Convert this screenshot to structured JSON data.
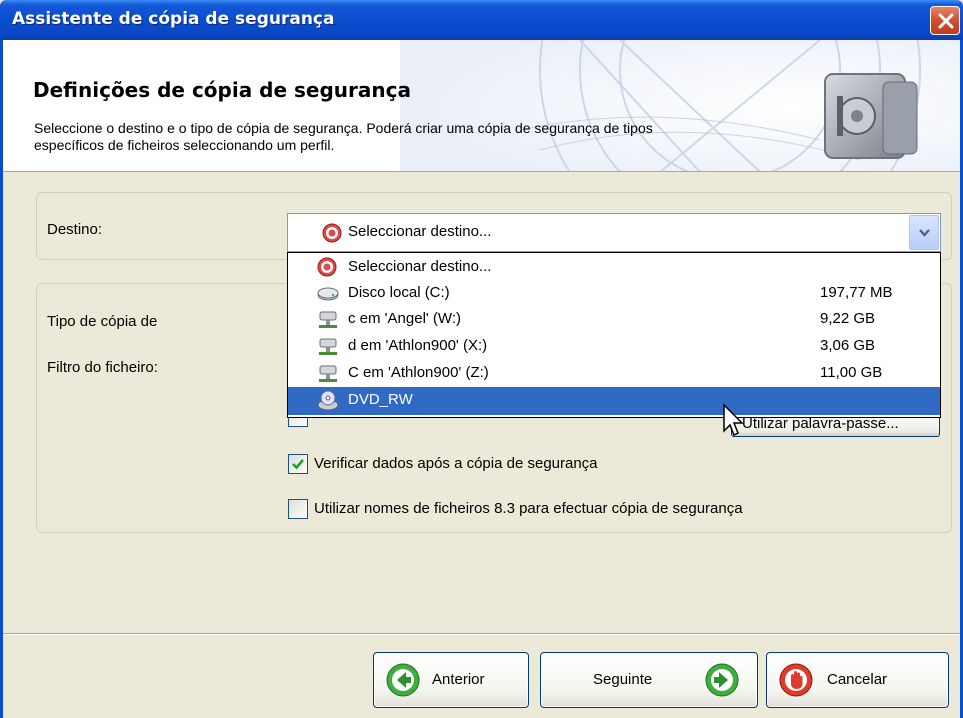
{
  "window": {
    "title": "Assistente de cópia de segurança",
    "close_icon": "close-icon"
  },
  "header": {
    "title": "Definições de cópia de segurança",
    "description": "Seleccione o destino e o tipo de cópia de segurança. Poderá criar uma cópia de segurança de tipos específicos de ficheiros seleccionando um perfil.",
    "art_icon": "safe-icon"
  },
  "destination": {
    "label": "Destino:",
    "selected_value": "Seleccionar destino...",
    "selected_icon": "target-icon"
  },
  "dropdown": {
    "items": [
      {
        "label": "Seleccionar destino...",
        "size": "",
        "icon": "target-icon"
      },
      {
        "label": "Disco local (C:)",
        "size": "197,77 MB",
        "icon": "hard-drive-icon"
      },
      {
        "label": "c em 'Angel' (W:)",
        "size": "9,22 GB",
        "icon": "network-drive-icon"
      },
      {
        "label": "d em 'Athlon900' (X:)",
        "size": "3,06 GB",
        "icon": "network-drive-icon"
      },
      {
        "label": "C em 'Athlon900' (Z:)",
        "size": "11,00 GB",
        "icon": "network-drive-icon"
      },
      {
        "label": "DVD_RW",
        "size": "",
        "icon": "dvd-drive-icon",
        "selected": true
      }
    ]
  },
  "options": {
    "backup_type_label": "Tipo de cópia de",
    "file_filter_label": "Filtro do ficheiro:",
    "password_button": "Utilizar palavra-passe...",
    "verify_label": "Verificar dados após a cópia de segurança",
    "verify_checked": true,
    "short_names_label": "Utilizar nomes de ficheiros 8.3 para efectuar cópia de segurança",
    "short_names_checked": false
  },
  "buttons": {
    "back": "Anterior",
    "next": "Seguinte",
    "cancel": "Cancelar"
  },
  "colors": {
    "titlebar": "#0a4ecf",
    "selection": "#316ac5",
    "dialog_bg": "#ece9d8"
  }
}
